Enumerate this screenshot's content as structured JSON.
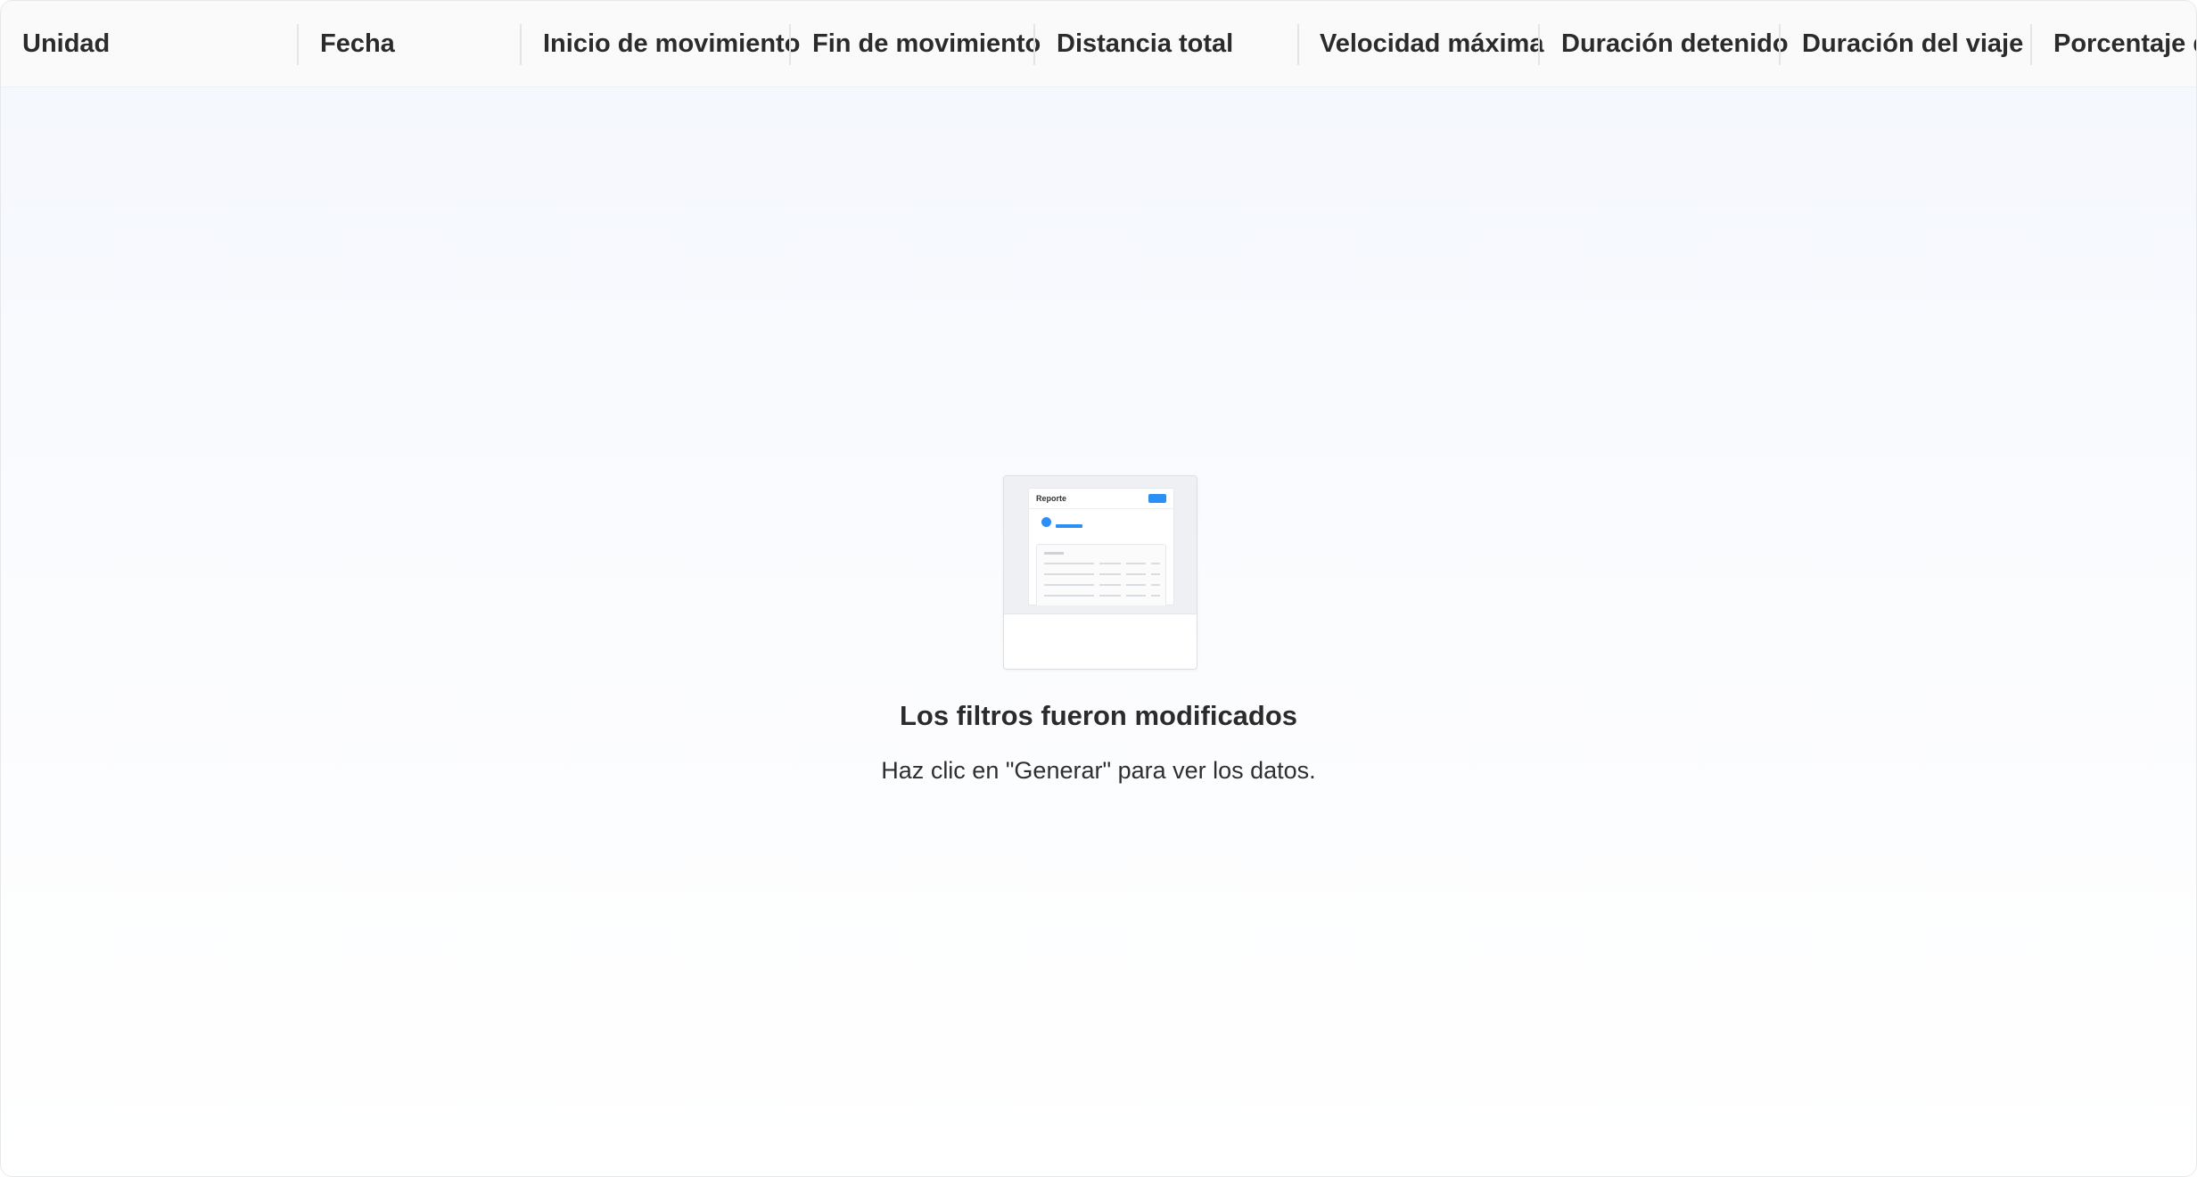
{
  "table": {
    "columns": [
      "Unidad",
      "Fecha",
      "Inicio de movimiento",
      "Fin de movimiento",
      "Distancia total",
      "Velocidad máxima",
      "Duración detenido",
      "Duración del viaje",
      "Porcentaje de"
    ]
  },
  "empty_state": {
    "illustration_title": "Reporte",
    "title": "Los filtros fueron modificados",
    "message": "Haz clic en \"Generar\" para ver los datos."
  },
  "colors": {
    "accent": "#2c8ff5",
    "header_bg": "#fafafa",
    "text": "#2b2b2b"
  },
  "icons": {
    "illustration": "report-preview-icon"
  }
}
